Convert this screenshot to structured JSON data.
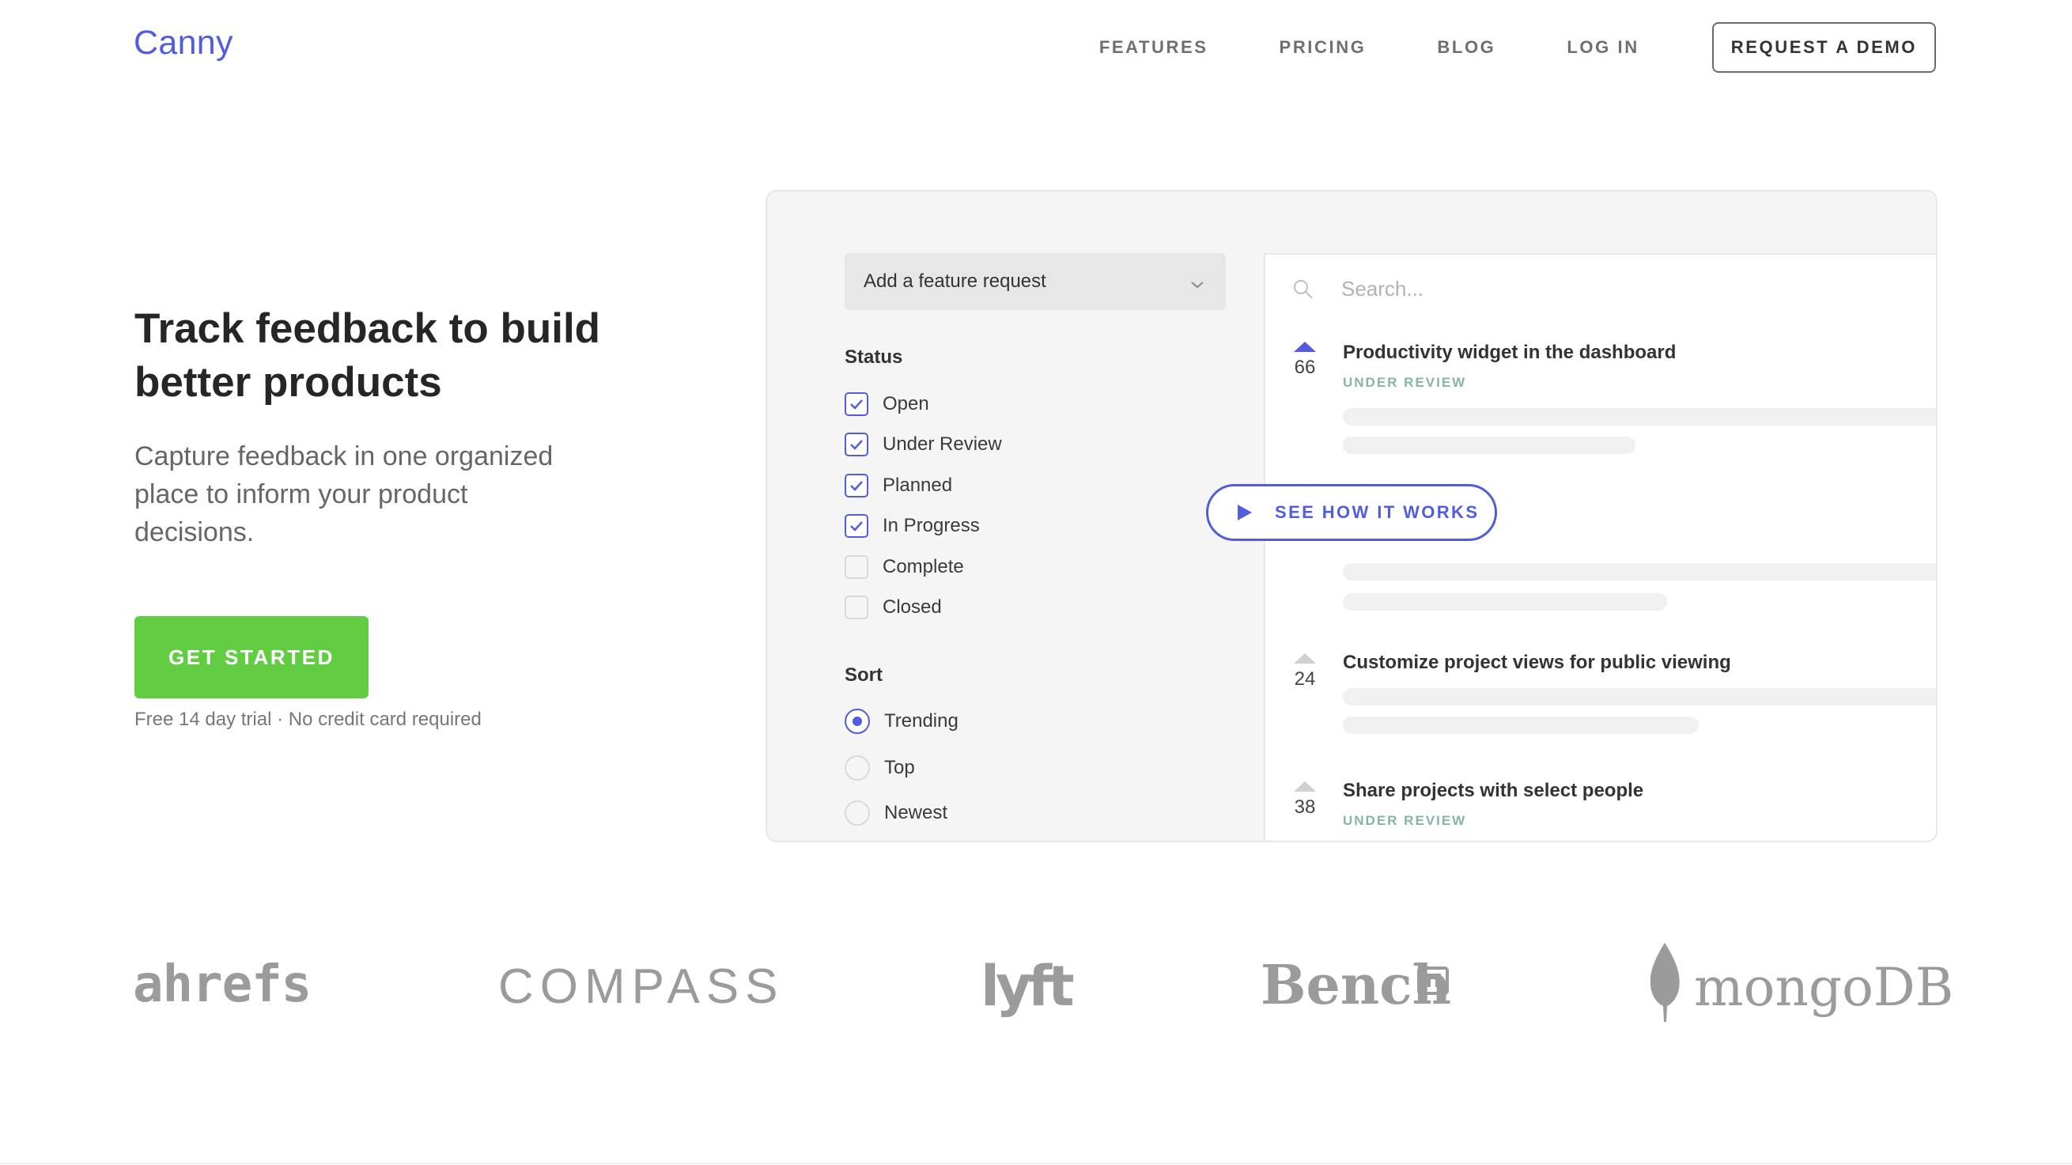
{
  "nav": {
    "logo": "Canny",
    "links": [
      "FEATURES",
      "PRICING",
      "BLOG",
      "LOG IN"
    ],
    "demo_button": "REQUEST A DEMO"
  },
  "hero": {
    "title": "Track feedback to build better products",
    "subtitle": "Capture feedback in one organized place to inform your product decisions.",
    "cta": "GET STARTED",
    "cta_note": "Free 14 day trial · No credit card required"
  },
  "demo": {
    "select_label": "Add a feature request",
    "status_title": "Status",
    "statuses": [
      {
        "label": "Open",
        "checked": true
      },
      {
        "label": "Under Review",
        "checked": true
      },
      {
        "label": "Planned",
        "checked": true
      },
      {
        "label": "In Progress",
        "checked": true
      },
      {
        "label": "Complete",
        "checked": false
      },
      {
        "label": "Closed",
        "checked": false
      }
    ],
    "sort_title": "Sort",
    "sorts": [
      {
        "label": "Trending",
        "selected": true
      },
      {
        "label": "Top",
        "selected": false
      },
      {
        "label": "Newest",
        "selected": false
      }
    ],
    "search_placeholder": "Search...",
    "posts": [
      {
        "title": "Productivity widget in the dashboard",
        "votes": "66",
        "status": "UNDER REVIEW",
        "voted": true
      },
      {
        "title": "Customize project views for public viewing",
        "votes": "24",
        "status": "",
        "voted": false
      },
      {
        "title": "Share projects with select people",
        "votes": "38",
        "status": "UNDER REVIEW",
        "voted": false
      }
    ],
    "how_button": "SEE HOW IT WORKS"
  },
  "logos": {
    "ahrefs": "ahrefs",
    "compass": "COMPASS",
    "lyft": "lyft",
    "bench": "Bench",
    "mongodb": "mongoDB"
  },
  "colors": {
    "brand": "#525dde",
    "cta": "#62cd43",
    "status_under_review": "#85b5a6",
    "logo_grey": "#9b9b9b"
  }
}
